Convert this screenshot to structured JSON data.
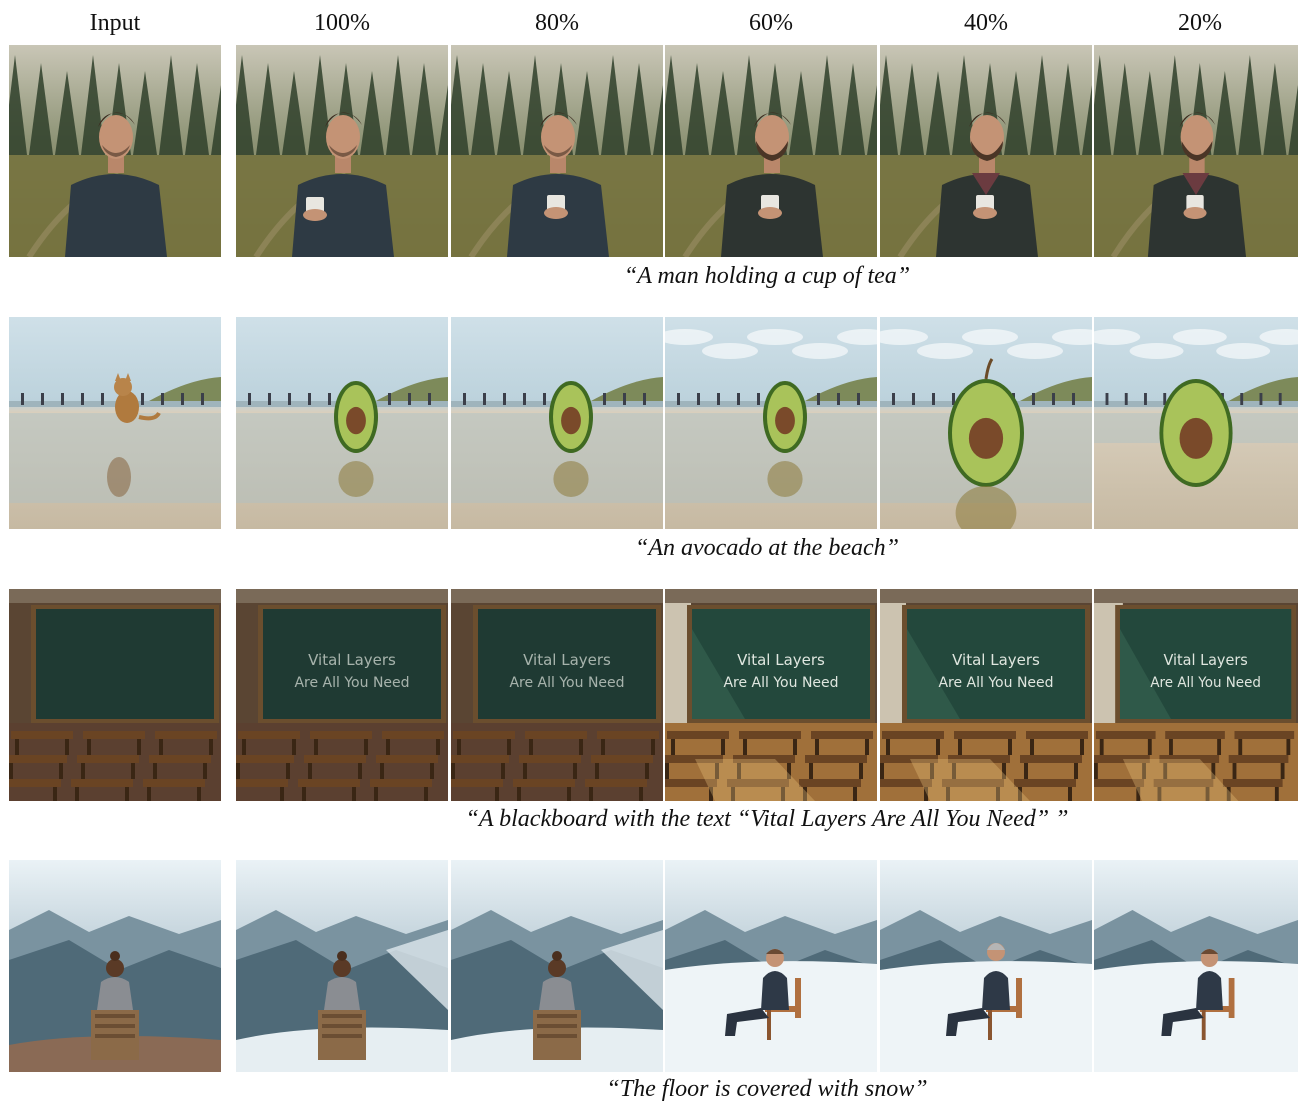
{
  "header": {
    "columns": [
      "Input",
      "100%",
      "80%",
      "60%",
      "40%",
      "20%"
    ]
  },
  "rows": [
    {
      "caption": "“A man holding a cup of tea”",
      "scene": "man-tea",
      "drawn_texts": []
    },
    {
      "caption": "“An avocado at the beach”",
      "scene": "avocado-beach",
      "drawn_texts": []
    },
    {
      "caption": "“A blackboard with the text “Vital Layers Are All You Need” ”",
      "scene": "blackboard",
      "board_line1": "Vital Layers",
      "board_line2": "Are All You Need"
    },
    {
      "caption": "“The floor is covered with snow”",
      "scene": "snow",
      "drawn_texts": []
    }
  ]
}
